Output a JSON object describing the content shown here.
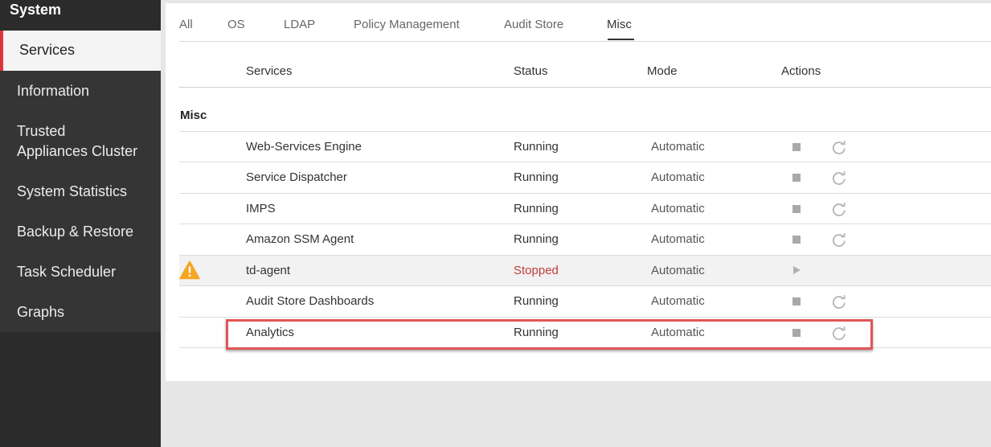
{
  "sidebar": {
    "title": "System",
    "active_item": "Services",
    "items": [
      {
        "label": "Information"
      },
      {
        "label": "Trusted Appliances Cluster",
        "line1": "Trusted",
        "line2": "Appliances Cluster"
      },
      {
        "label": "System Statistics"
      },
      {
        "label": "Backup & Restore"
      },
      {
        "label": "Task Scheduler"
      },
      {
        "label": "Graphs"
      }
    ]
  },
  "tabs": [
    {
      "label": "All"
    },
    {
      "label": "OS"
    },
    {
      "label": "LDAP"
    },
    {
      "label": "Policy Management"
    },
    {
      "label": "Audit Store"
    },
    {
      "label": "Misc",
      "active": true
    }
  ],
  "table": {
    "columns": [
      "Services",
      "Status",
      "Mode",
      "Actions"
    ],
    "section": "Misc",
    "rows": [
      {
        "service": "Web-Services Engine",
        "status": "Running",
        "mode": "Automatic",
        "actions": [
          "stop-icon",
          "restart-icon"
        ]
      },
      {
        "service": "Service Dispatcher",
        "status": "Running",
        "mode": "Automatic",
        "actions": [
          "stop-icon",
          "restart-icon"
        ]
      },
      {
        "service": "IMPS",
        "status": "Running",
        "mode": "Automatic",
        "actions": [
          "stop-icon",
          "restart-icon"
        ]
      },
      {
        "service": "Amazon SSM Agent",
        "status": "Running",
        "mode": "Automatic",
        "actions": [
          "stop-icon",
          "restart-icon"
        ]
      },
      {
        "service": "td-agent",
        "status": "Stopped",
        "mode": "Automatic",
        "warning": true,
        "actions": [
          "play-icon"
        ]
      },
      {
        "service": "Audit Store Dashboards",
        "status": "Running",
        "mode": "Automatic",
        "actions": [
          "stop-icon",
          "restart-icon"
        ]
      },
      {
        "service": "Analytics",
        "status": "Running",
        "mode": "Automatic",
        "highlighted": true,
        "actions": [
          "stop-icon",
          "restart-icon"
        ]
      }
    ]
  },
  "colors": {
    "sidebar_bg": "#2b2b2b",
    "active_accent": "#e0323c",
    "stopped_text": "#c23b3b",
    "warning_icon": "#f5a623",
    "highlight_border": "#e05555"
  }
}
